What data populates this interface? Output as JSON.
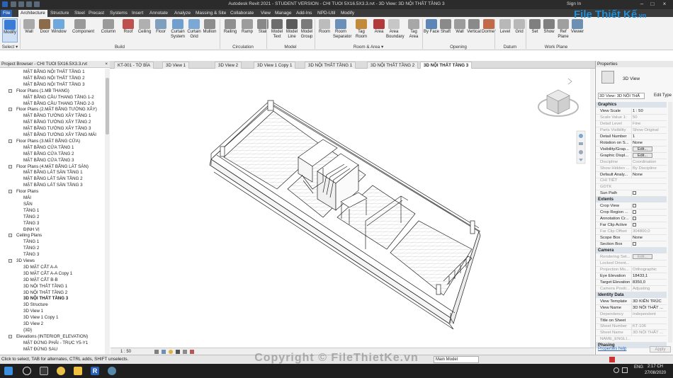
{
  "app": {
    "title": "Autodesk Revit 2021 - STUDENT VERSION - CHI TUOI 5X16.5X3.3.rvt - 3D View: 3D NỘI THẤT TẦNG 3",
    "signin": "Sign In",
    "logo_text": "File Thiết Kế",
    "logo_suffix": ".vn",
    "watermark": "Copyright © FileThietKe.vn"
  },
  "ribbon_tabs": [
    "File",
    "Architecture",
    "Structure",
    "Steel",
    "Precast",
    "Systems",
    "Insert",
    "Annotate",
    "Analyze",
    "Massing & Site",
    "Collaborate",
    "View",
    "Manage",
    "Add-Ins",
    "NPD-Util",
    "Modify"
  ],
  "ribbon": {
    "buttons": [
      {
        "label": "Modify",
        "color": "#3a7bd5"
      },
      {
        "label": "Wall",
        "color": "#a9a9a9"
      },
      {
        "label": "Door",
        "color": "#8b6b4a"
      },
      {
        "label": "Window",
        "color": "#6fa8dc"
      },
      {
        "label": "Component",
        "color": "#999999"
      },
      {
        "label": "Column",
        "color": "#9a9a9a"
      },
      {
        "label": "Roof",
        "color": "#c0504d"
      },
      {
        "label": "Ceiling",
        "color": "#b0b0b0"
      },
      {
        "label": "Floor",
        "color": "#7f9fbf"
      },
      {
        "label": "Curtain System",
        "color": "#6f9fcf"
      },
      {
        "label": "Curtain Grid",
        "color": "#7ca8d6"
      },
      {
        "label": "Mullion",
        "color": "#8d8d8d"
      },
      {
        "label": "Railing",
        "color": "#8f8f8f"
      },
      {
        "label": "Ramp",
        "color": "#9c9c9c"
      },
      {
        "label": "Stair",
        "color": "#888888"
      },
      {
        "label": "Model Text",
        "color": "#6d6d6d"
      },
      {
        "label": "Model Line",
        "color": "#5b5b5b"
      },
      {
        "label": "Model Group",
        "color": "#7a7a7a"
      },
      {
        "label": "Room",
        "color": "#bcbcbc"
      },
      {
        "label": "Room Separator",
        "color": "#6a8fb8"
      },
      {
        "label": "Tag Room",
        "color": "#c28b3b"
      },
      {
        "label": "Area",
        "color": "#b33a3a"
      },
      {
        "label": "Area Boundary",
        "color": "#c7c7c7"
      },
      {
        "label": "Tag Area",
        "color": "#a7a7a7"
      },
      {
        "label": "By Face",
        "color": "#5d86b8"
      },
      {
        "label": "Shaft",
        "color": "#8a8a8a"
      },
      {
        "label": "Wall",
        "color": "#9c9c9c"
      },
      {
        "label": "Vertical",
        "color": "#8a8a8a"
      },
      {
        "label": "Dormer",
        "color": "#c06a4a"
      },
      {
        "label": "Level",
        "color": "#b8b8b8"
      },
      {
        "label": "Grid",
        "color": "#b8b8b8"
      },
      {
        "label": "Set",
        "color": "#7f7f7f"
      },
      {
        "label": "Show",
        "color": "#7f7f7f"
      },
      {
        "label": "Ref Plane",
        "color": "#9f9f9f"
      },
      {
        "label": "Viewer",
        "color": "#6d8fb2"
      }
    ],
    "panels": [
      "Select ▾",
      "Build",
      "Circulation",
      "Model",
      "Room & Area ▾",
      "Opening",
      "Datum",
      "Work Plane"
    ]
  },
  "project_browser": {
    "header": "Project Browser - CHI TUOI 5X16.5X3.3.rvt",
    "rows": [
      {
        "text": "MẶT BẰNG NỘI THẤT TẦNG 1",
        "level": 2
      },
      {
        "text": "MẶT BẰNG NỘI THẤT TẦNG 2",
        "level": 2
      },
      {
        "text": "MẶT BẰNG NỘI THẤT TẦNG 3",
        "level": 2
      },
      {
        "text": "Floor Plans (1.MB THANG)",
        "level": 1,
        "toggle": "−"
      },
      {
        "text": "MẶT BẰNG CẦU THANG TẦNG 1-2",
        "level": 2
      },
      {
        "text": "MẶT BẰNG CẦU THANG TẦNG 2-3",
        "level": 2
      },
      {
        "text": "Floor Plans (2.MẶT BẰNG TƯỜNG XÂY)",
        "level": 1,
        "toggle": "−"
      },
      {
        "text": "MẶT BẰNG TƯỜNG XÂY TẦNG 1",
        "level": 2
      },
      {
        "text": "MẶT BẰNG TƯỜNG XÂY TẦNG 2",
        "level": 2
      },
      {
        "text": "MẶT BẰNG TƯỜNG XÂY TẦNG 3",
        "level": 2
      },
      {
        "text": "MẶT BẰNG TƯỜNG XÂY TẦNG MÁI",
        "level": 2
      },
      {
        "text": "Floor Plans (3.MẶT BẰNG CỬA)",
        "level": 1,
        "toggle": "−"
      },
      {
        "text": "MẶT BẰNG CỬA TẦNG 1",
        "level": 2
      },
      {
        "text": "MẶT BẰNG CỬA TẦNG 2",
        "level": 2
      },
      {
        "text": "MẶT BẰNG CỬA TẦNG 3",
        "level": 2
      },
      {
        "text": "Floor Plans (4.MẶT BẰNG LÁT SÀN)",
        "level": 1,
        "toggle": "−"
      },
      {
        "text": "MẶT BẰNG LÁT SÀN TẦNG 1",
        "level": 2
      },
      {
        "text": "MẶT BẰNG LÁT SÀN TẦNG 2",
        "level": 2
      },
      {
        "text": "MẶT BẰNG LÁT SÀN TẦNG 3",
        "level": 2
      },
      {
        "text": "Floor Plans",
        "level": 1,
        "toggle": "−"
      },
      {
        "text": "MÁI",
        "level": 2
      },
      {
        "text": "SÂN",
        "level": 2
      },
      {
        "text": "TẦNG 1",
        "level": 2
      },
      {
        "text": "TẦNG 2",
        "level": 2
      },
      {
        "text": "TẦNG 3",
        "level": 2
      },
      {
        "text": "ĐỊNH VỊ",
        "level": 2
      },
      {
        "text": "Ceiling Plans",
        "level": 1,
        "toggle": "−"
      },
      {
        "text": "TẦNG 1",
        "level": 2
      },
      {
        "text": "TẦNG 2",
        "level": 2
      },
      {
        "text": "TẦNG 3",
        "level": 2
      },
      {
        "text": "3D Views",
        "level": 1,
        "toggle": "−"
      },
      {
        "text": "3D MẶT CẮT A-A",
        "level": 2
      },
      {
        "text": "3D MẶT CẮT A-A Copy 1",
        "level": 2
      },
      {
        "text": "3D MẶT CẮT B-B",
        "level": 2
      },
      {
        "text": "3D NỘI THẤT TẦNG 1",
        "level": 2
      },
      {
        "text": "3D NỘI THẤT TẦNG 2",
        "level": 2
      },
      {
        "text": "3D NỘI THẤT TẦNG 3",
        "level": 2,
        "selected": true
      },
      {
        "text": "3D Structure",
        "level": 2
      },
      {
        "text": "3D View 1",
        "level": 2
      },
      {
        "text": "3D View 1 Copy 1",
        "level": 2
      },
      {
        "text": "3D View 2",
        "level": 2
      },
      {
        "text": "{3D}",
        "level": 2
      },
      {
        "text": "Elevations (INTERIOR_ELEVATION)",
        "level": 1,
        "toggle": "−"
      },
      {
        "text": "MẶT ĐỨNG PHẢI - TRỤC Y5-Y1",
        "level": 2
      },
      {
        "text": "MẶT ĐỨNG SAU",
        "level": 2
      }
    ]
  },
  "view_tabs": [
    "KT-001 - TỜ BÌA",
    "3D View 1",
    "3D View 2",
    "3D View 1 Copy 1",
    "3D NỘI THẤT TẦNG 1",
    "3D NỘI THẤT TẦNG 2",
    "3D NỘI THẤT TẦNG 3"
  ],
  "view_bar": {
    "scale": "1 : 50"
  },
  "properties": {
    "header": "Properties",
    "type_name": "3D View",
    "selector": "3D View: 3D NỘI THẤ",
    "edit_type": "Edit Type",
    "groups": [
      {
        "name": "Graphics",
        "rows": [
          {
            "k": "View Scale",
            "v": "1 : 50"
          },
          {
            "k": "Scale Value 1:",
            "v": "50",
            "dim": true
          },
          {
            "k": "Detail Level",
            "v": "Fine",
            "dim": true
          },
          {
            "k": "Parts Visibility",
            "v": "Show Original",
            "dim": true
          },
          {
            "k": "Detail Number",
            "v": "1"
          },
          {
            "k": "Rotation on S...",
            "v": "None"
          },
          {
            "k": "Visibility/Grap...",
            "v": "Edit...",
            "btn": true
          },
          {
            "k": "Graphic Displ...",
            "v": "Edit...",
            "btn": true
          },
          {
            "k": "Discipline",
            "v": "Coordination",
            "dim": true
          },
          {
            "k": "Show Hidden ...",
            "v": "By Discipline",
            "dim": true
          },
          {
            "k": "Default Analy...",
            "v": "None"
          },
          {
            "k": "CHI TIẾT",
            "v": "",
            "dim": true
          },
          {
            "k": "GDTK",
            "v": "",
            "dim": true
          },
          {
            "k": "Sun Path",
            "v": "",
            "check": true
          }
        ]
      },
      {
        "name": "Extents",
        "rows": [
          {
            "k": "Crop View",
            "v": "",
            "check": true
          },
          {
            "k": "Crop Region ...",
            "v": "",
            "check": true
          },
          {
            "k": "Annotation Cr...",
            "v": "",
            "check": true
          },
          {
            "k": "Far Clip Active",
            "v": "",
            "check": true
          },
          {
            "k": "Far Clip Offset",
            "v": "304800,0",
            "dim": true
          },
          {
            "k": "Scope Box",
            "v": "None"
          },
          {
            "k": "Section Box",
            "v": "☑",
            "check": true
          }
        ]
      },
      {
        "name": "Camera",
        "rows": [
          {
            "k": "Rendering Set...",
            "v": "Edit...",
            "btn": true,
            "dim": true
          },
          {
            "k": "Locked Orient...",
            "v": "",
            "dim": true
          },
          {
            "k": "Projection Mo...",
            "v": "Orthographic",
            "dim": true
          },
          {
            "k": "Eye Elevation",
            "v": "18433,1"
          },
          {
            "k": "Target Elevation",
            "v": "8350,0"
          },
          {
            "k": "Camera Positi...",
            "v": "Adjusting",
            "dim": true
          }
        ]
      },
      {
        "name": "Identity Data",
        "rows": [
          {
            "k": "View Template",
            "v": "3D KIẾN TRÚC"
          },
          {
            "k": "View Name",
            "v": "3D NỘI THẤT ..."
          },
          {
            "k": "Dependency",
            "v": "Independent",
            "dim": true
          },
          {
            "k": "Title on Sheet",
            "v": ""
          },
          {
            "k": "Sheet Number",
            "v": "KT-106",
            "dim": true
          },
          {
            "k": "Sheet Name",
            "v": "3D NỘI THẤT ...",
            "dim": true
          },
          {
            "k": "NAME_ENGLI...",
            "v": "",
            "dim": true
          }
        ]
      },
      {
        "name": "Phasing",
        "rows": []
      }
    ],
    "help": "Properties help",
    "apply": "Apply"
  },
  "status_bar": {
    "message": "Click to select, TAB for alternates, CTRL adds, SHIFT unselects.",
    "model": "Main Model"
  },
  "taskbar": {
    "time": "2:17 CH",
    "date": "27/08/2020",
    "lang": "ENG"
  },
  "colors": {
    "accent": "#2a62b5",
    "ribbon_bg": "#f2f2f2",
    "dark_bar": "#2b2b2b"
  }
}
